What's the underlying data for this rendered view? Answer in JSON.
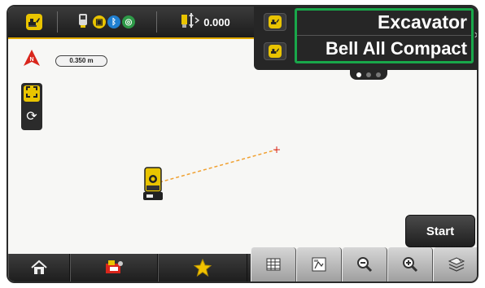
{
  "status_bar": {
    "machine_icon": "excavator-icon",
    "gps_icon": "gps-receiver-icon",
    "status_icons": [
      "sd-card-icon",
      "bluetooth-icon",
      "network-icon"
    ],
    "height_icon": "measurement-height-icon",
    "height_value": "0.000"
  },
  "machine_panel": {
    "title": "Excavator",
    "subtitle": "Bell All Compact",
    "pages": 3,
    "active_page": 1
  },
  "map": {
    "north_label": "N",
    "scale_label": "0.350 m"
  },
  "actions": {
    "start_label": "Start"
  },
  "bottom_toolbar": {
    "left_items": [
      "home-icon",
      "machine-settings-icon",
      "favorites-icon"
    ],
    "right_items": [
      "table-view-icon",
      "plan-view-icon",
      "zoom-out-icon",
      "zoom-in-icon",
      "layers-icon"
    ]
  },
  "colors": {
    "accent_yellow": "#e9c400",
    "highlight_green": "#19a74a",
    "north_red": "#d9261c",
    "track_orange": "#f0a030"
  }
}
